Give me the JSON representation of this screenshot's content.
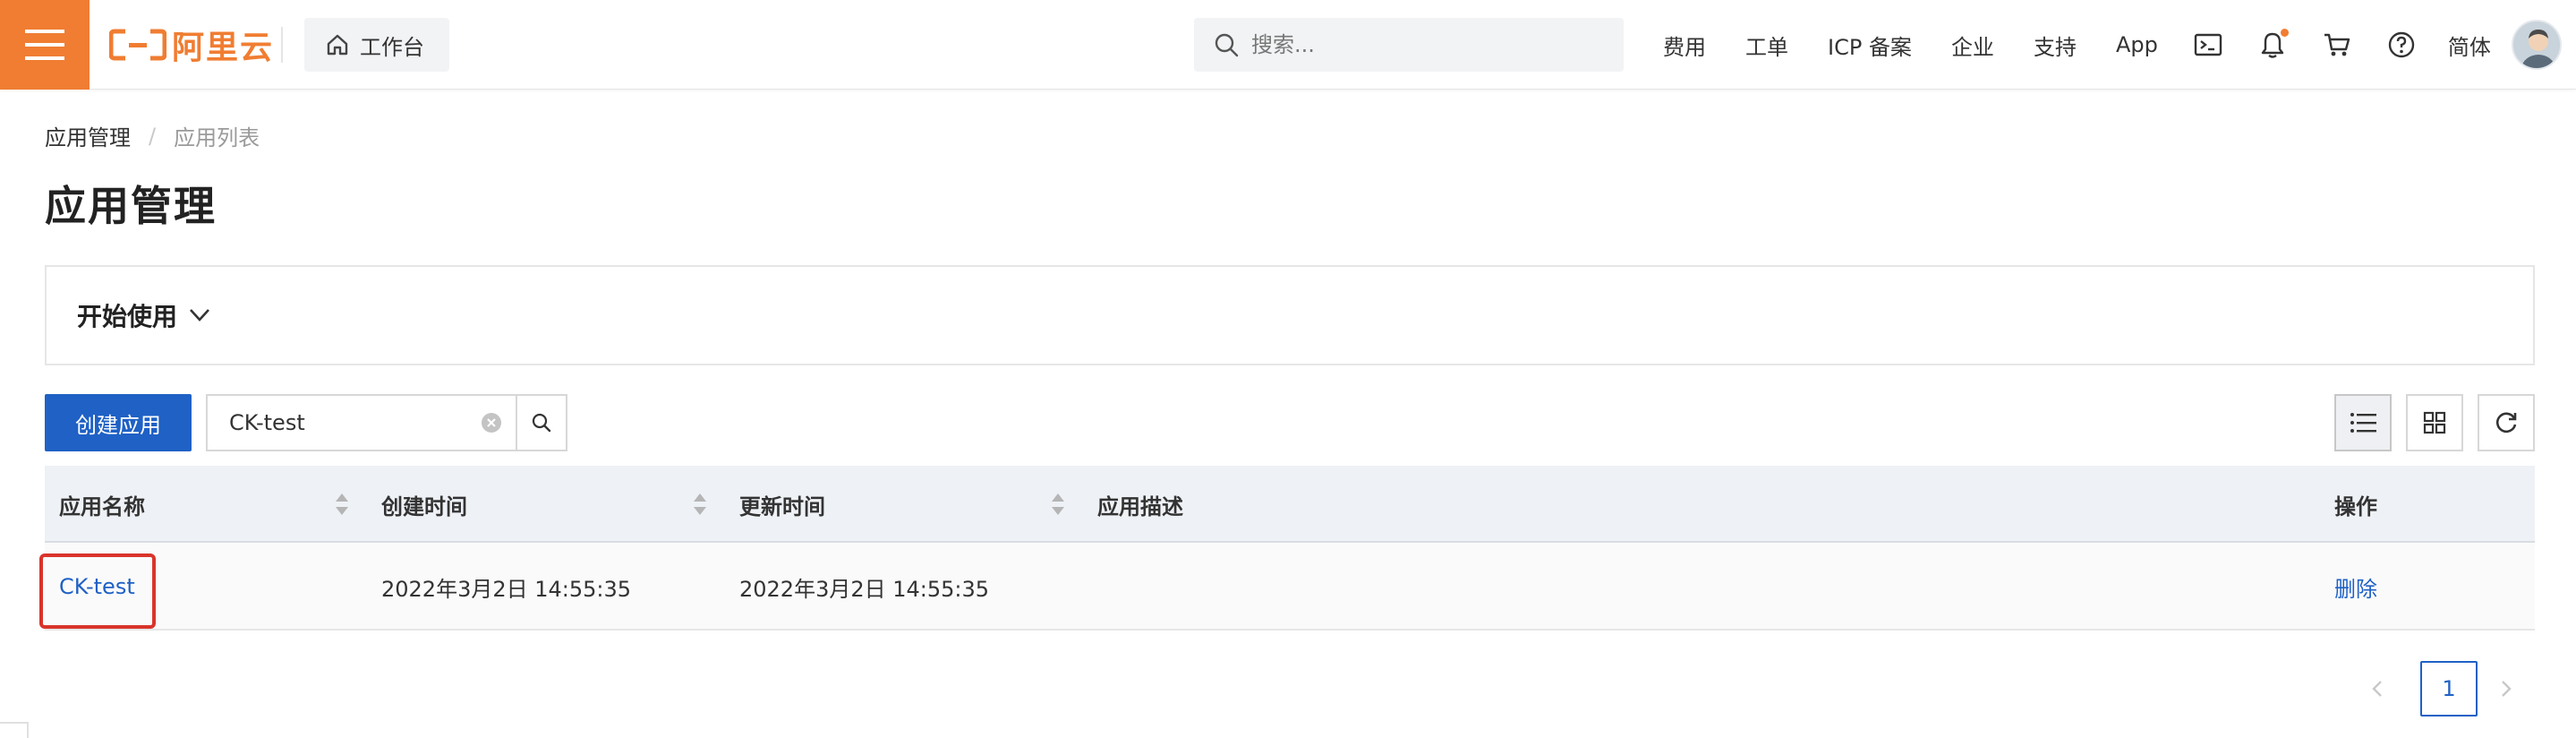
{
  "topbar": {
    "logo_text": "阿里云",
    "workbench_label": "工作台",
    "search_placeholder": "搜索...",
    "nav": [
      "费用",
      "工单",
      "ICP 备案",
      "企业",
      "支持",
      "App"
    ],
    "lang": "简体",
    "icons": [
      "terminal-icon",
      "bell-icon",
      "cart-icon",
      "help-icon"
    ],
    "accent_color": "#f07d32"
  },
  "breadcrumb": {
    "parent": "应用管理",
    "separator": "/",
    "current": "应用列表"
  },
  "page_title": "应用管理",
  "start_panel": {
    "label": "开始使用"
  },
  "toolbar": {
    "create_label": "创建应用",
    "filter_value": "CK-test",
    "primary_color": "#1f61c5"
  },
  "table": {
    "headers": [
      "应用名称",
      "创建时间",
      "更新时间",
      "应用描述",
      "操作"
    ],
    "rows": [
      {
        "name": "CK-test",
        "created": "2022年3月2日 14:55:35",
        "updated": "2022年3月2日 14:55:35",
        "description": "",
        "action": "删除"
      }
    ]
  },
  "pagination": {
    "current_page": "1"
  }
}
